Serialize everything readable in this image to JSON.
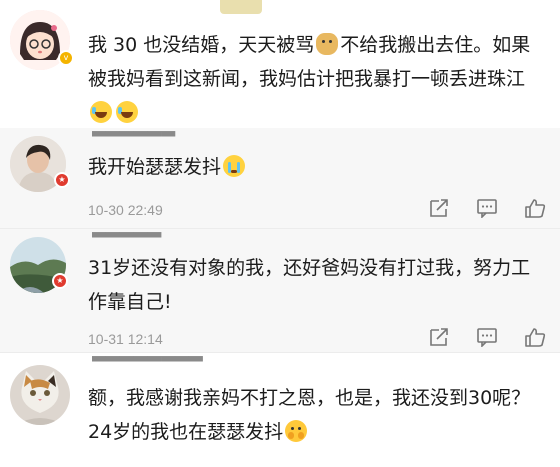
{
  "comments": [
    {
      "text": "我 30 也没结婚，天天被骂",
      "text_after_emoji": "不给我搬出去住。如果被我妈看到这新闻，我妈估计把我暴打一顿丢进珠江",
      "emoji": [
        "doge-icon",
        "laugh-cry-icon",
        "laugh-cry-icon"
      ],
      "badge_color": "#f4b400"
    },
    {
      "text": "我开始瑟瑟发抖",
      "emoji": [
        "cry-icon"
      ],
      "time": "10-30 22:49",
      "badge_color": "#e03b2f"
    },
    {
      "text": "31岁还没有对象的我，还好爸妈没有打过我，努力工作靠自己!",
      "time": "10-31 12:14",
      "badge_color": "#e03b2f"
    },
    {
      "text": "额，我感谢我亲妈不打之恩，也是，我还没到30呢？24岁的我也在瑟瑟发抖",
      "emoji": [
        "hide-face-icon"
      ]
    }
  ],
  "actions": [
    "forward-icon",
    "comment-icon",
    "like-icon"
  ]
}
